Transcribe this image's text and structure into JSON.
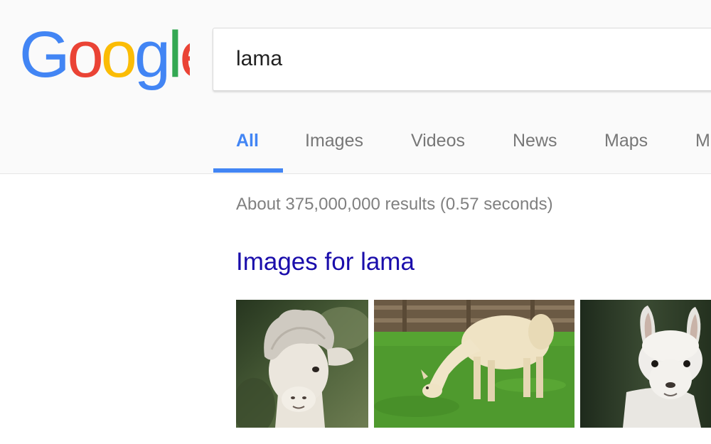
{
  "logo": {
    "letters": [
      "G",
      "o",
      "o",
      "g",
      "l",
      "e"
    ],
    "colors": [
      "#4285f4",
      "#ea4335",
      "#fbbc05",
      "#4285f4",
      "#34a853",
      "#ea4335"
    ]
  },
  "search": {
    "value": "lama"
  },
  "tabs": [
    {
      "label": "All",
      "active": true
    },
    {
      "label": "Images",
      "active": false
    },
    {
      "label": "Videos",
      "active": false
    },
    {
      "label": "News",
      "active": false
    },
    {
      "label": "Maps",
      "active": false
    },
    {
      "label": "M",
      "active": false
    }
  ],
  "results": {
    "stats": "About 375,000,000 results (0.57 seconds)",
    "images_heading": "Images for lama"
  },
  "colors": {
    "accent": "#4285f4",
    "link": "#1a0dab",
    "muted": "#808080"
  }
}
